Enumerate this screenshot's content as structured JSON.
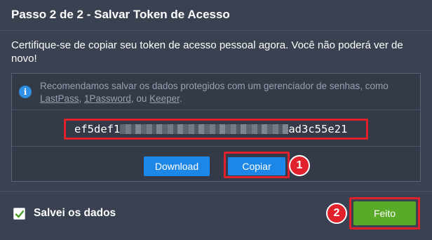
{
  "dialog": {
    "title": "Passo 2 de 2 - Salvar Token de Acesso",
    "subtitle": "Certifique-se de copiar seu token de acesso pessoal agora. Você não poderá ver de novo!"
  },
  "info": {
    "text_before": "Recomendamos salvar os dados protegidos com um gerenciador de senhas, como ",
    "link_lastpass": "LastPass",
    "sep1": ", ",
    "link_1password": "1Password",
    "sep2": ", ou ",
    "link_keeper": "Keeper",
    "text_after": ".",
    "icon": "info-icon"
  },
  "token": {
    "visible_start": "ef5def1",
    "visible_end": "ad3c55e21"
  },
  "buttons": {
    "download_label": "Download",
    "copy_label": "Copiar",
    "done_label": "Feito"
  },
  "badges": {
    "copy_badge": "1",
    "done_badge": "2"
  },
  "footer": {
    "checkbox_label": "Salvei os dados",
    "checkbox_checked": true
  },
  "colors": {
    "background": "#3a4150",
    "primary_button": "#1d87e8",
    "success_button": "#5aaa2a",
    "highlight": "#e0202a",
    "info_icon": "#2f8fe4"
  }
}
